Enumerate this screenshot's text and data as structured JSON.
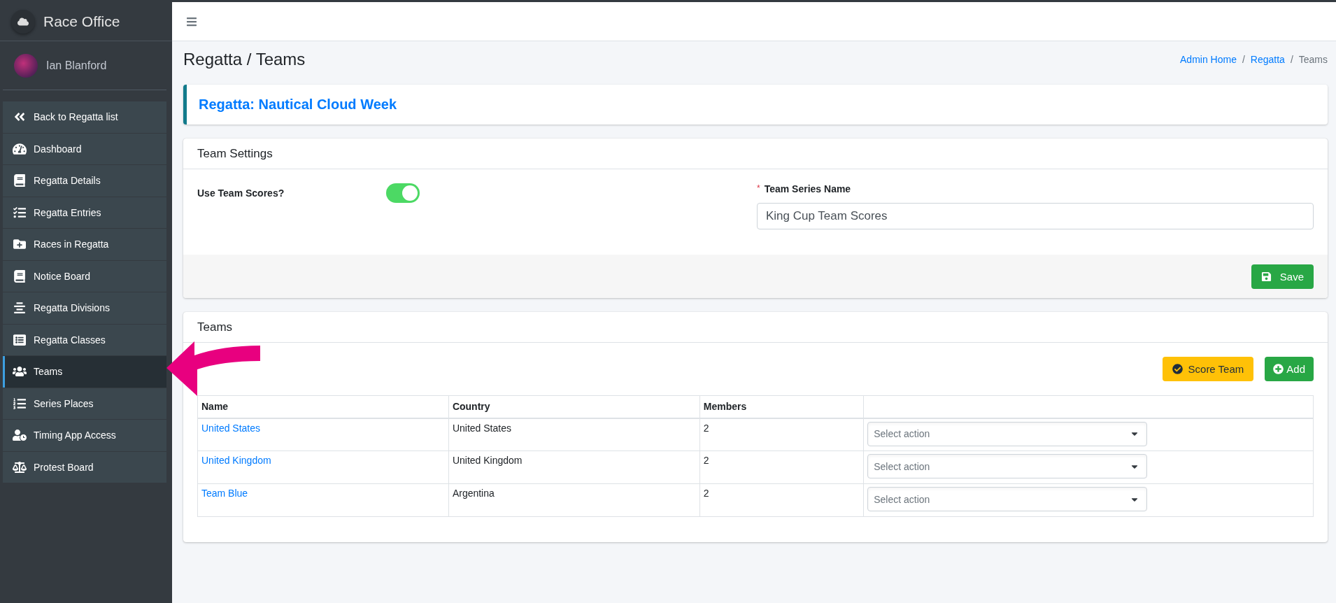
{
  "sidebar": {
    "brand": "Race Office",
    "user": "Ian Blanford",
    "items": [
      {
        "kind": "back",
        "label": "Back to Regatta list",
        "selected": false
      },
      {
        "kind": "dashboard",
        "label": "Dashboard",
        "selected": false
      },
      {
        "kind": "book",
        "label": "Regatta Details",
        "selected": false
      },
      {
        "kind": "checklist",
        "label": "Regatta Entries",
        "selected": false
      },
      {
        "kind": "folder",
        "label": "Races in Regatta",
        "selected": false
      },
      {
        "kind": "book",
        "label": "Notice Board",
        "selected": false
      },
      {
        "kind": "lines",
        "label": "Regatta Divisions",
        "selected": false
      },
      {
        "kind": "list",
        "label": "Regatta Classes",
        "selected": false
      },
      {
        "kind": "users",
        "label": "Teams",
        "selected": true
      },
      {
        "kind": "numbered",
        "label": "Series Places",
        "selected": false
      },
      {
        "kind": "userclock",
        "label": "Timing App Access",
        "selected": false
      },
      {
        "kind": "scale",
        "label": "Protest Board",
        "selected": false
      }
    ]
  },
  "page_title": "Regatta / Teams",
  "breadcrumb": {
    "separator": "/",
    "items": [
      {
        "label": "Admin Home",
        "link": true
      },
      {
        "label": "Regatta",
        "link": true
      },
      {
        "label": "Teams",
        "link": false
      }
    ]
  },
  "regatta_card": {
    "title": "Regatta: Nautical Cloud Week"
  },
  "team_settings": {
    "title": "Team Settings",
    "use_team_scores": {
      "label": "Use Team Scores?",
      "on": true
    },
    "series_name": {
      "label": "Team Series Name",
      "required_mark": "*",
      "value": "King Cup Team Scores"
    },
    "save_button": "Save"
  },
  "teams": {
    "title": "Teams",
    "buttons": [
      {
        "kind": "score",
        "label": "Score Team"
      },
      {
        "kind": "add",
        "label": "Add"
      }
    ],
    "table": {
      "columns": [
        "Name",
        "Country",
        "Members"
      ],
      "rows": [
        {
          "name": "United States",
          "country": "United States",
          "members": "2",
          "action_placeholder": "Select action"
        },
        {
          "name": "United Kingdom",
          "country": "United Kingdom",
          "members": "2",
          "action_placeholder": "Select action"
        },
        {
          "name": "Team Blue",
          "country": "Argentina",
          "members": "2",
          "action_placeholder": "Select action"
        }
      ]
    }
  }
}
